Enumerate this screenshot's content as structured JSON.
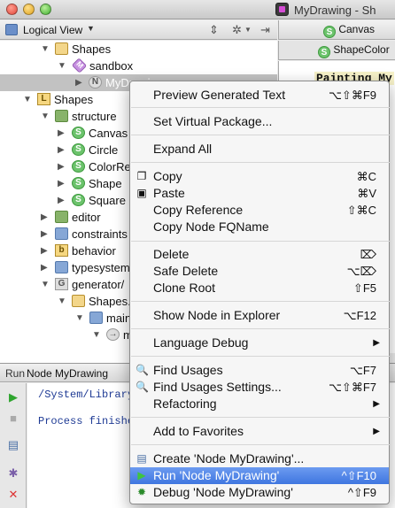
{
  "window": {
    "title": "MyDrawing - Sh"
  },
  "project_panel": {
    "view_label": "Logical View"
  },
  "editor": {
    "tab1": "Canvas",
    "tab2": "ShapeColor",
    "code": "Painting My"
  },
  "tree": {
    "rows": [
      {
        "label": "Shapes"
      },
      {
        "label": "sandbox"
      },
      {
        "label": "MyDrawing"
      },
      {
        "label": "Shapes"
      },
      {
        "label": "structure"
      },
      {
        "label": "Canvas"
      },
      {
        "label": "Circle"
      },
      {
        "label": "ColorRe"
      },
      {
        "label": "Shape"
      },
      {
        "label": "Square"
      },
      {
        "label": "editor"
      },
      {
        "label": "constraints"
      },
      {
        "label": "behavior"
      },
      {
        "label": "typesystem"
      },
      {
        "label": "generator/"
      },
      {
        "label": "Shapes."
      },
      {
        "label": "main"
      },
      {
        "label": "m"
      }
    ]
  },
  "run_panel": {
    "label": "Run",
    "tab": "Node MyDrawing",
    "console": [
      "/System/Library",
      "Process finishe"
    ]
  },
  "context_menu": {
    "items": [
      {
        "label": "Preview Generated Text",
        "shortcut": "⌥⇧⌘F9"
      },
      {
        "label": "Set Virtual Package...",
        "shortcut": ""
      },
      {
        "label": "Expand All",
        "shortcut": ""
      },
      {
        "label": "Copy",
        "shortcut": "⌘C"
      },
      {
        "label": "Paste",
        "shortcut": "⌘V"
      },
      {
        "label": "Copy Reference",
        "shortcut": "⇧⌘C"
      },
      {
        "label": "Copy Node FQName",
        "shortcut": ""
      },
      {
        "label": "Delete",
        "shortcut": "⌦"
      },
      {
        "label": "Safe Delete",
        "shortcut": "⌥⌦"
      },
      {
        "label": "Clone Root",
        "shortcut": "⇧F5"
      },
      {
        "label": "Show Node in Explorer",
        "shortcut": "⌥F12"
      },
      {
        "label": "Language Debug",
        "shortcut": ""
      },
      {
        "label": "Find Usages",
        "shortcut": "⌥F7"
      },
      {
        "label": "Find Usages Settings...",
        "shortcut": "⌥⇧⌘F7"
      },
      {
        "label": "Refactoring",
        "shortcut": ""
      },
      {
        "label": "Add to Favorites",
        "shortcut": ""
      },
      {
        "label": "Create 'Node MyDrawing'...",
        "shortcut": ""
      },
      {
        "label": "Run 'Node MyDrawing'",
        "shortcut": "^⇧F10"
      },
      {
        "label": "Debug 'Node MyDrawing'",
        "shortcut": "^⇧F9"
      }
    ]
  },
  "colors": {
    "highlight": "#3f76e0",
    "selection": "#c2c2c2"
  }
}
